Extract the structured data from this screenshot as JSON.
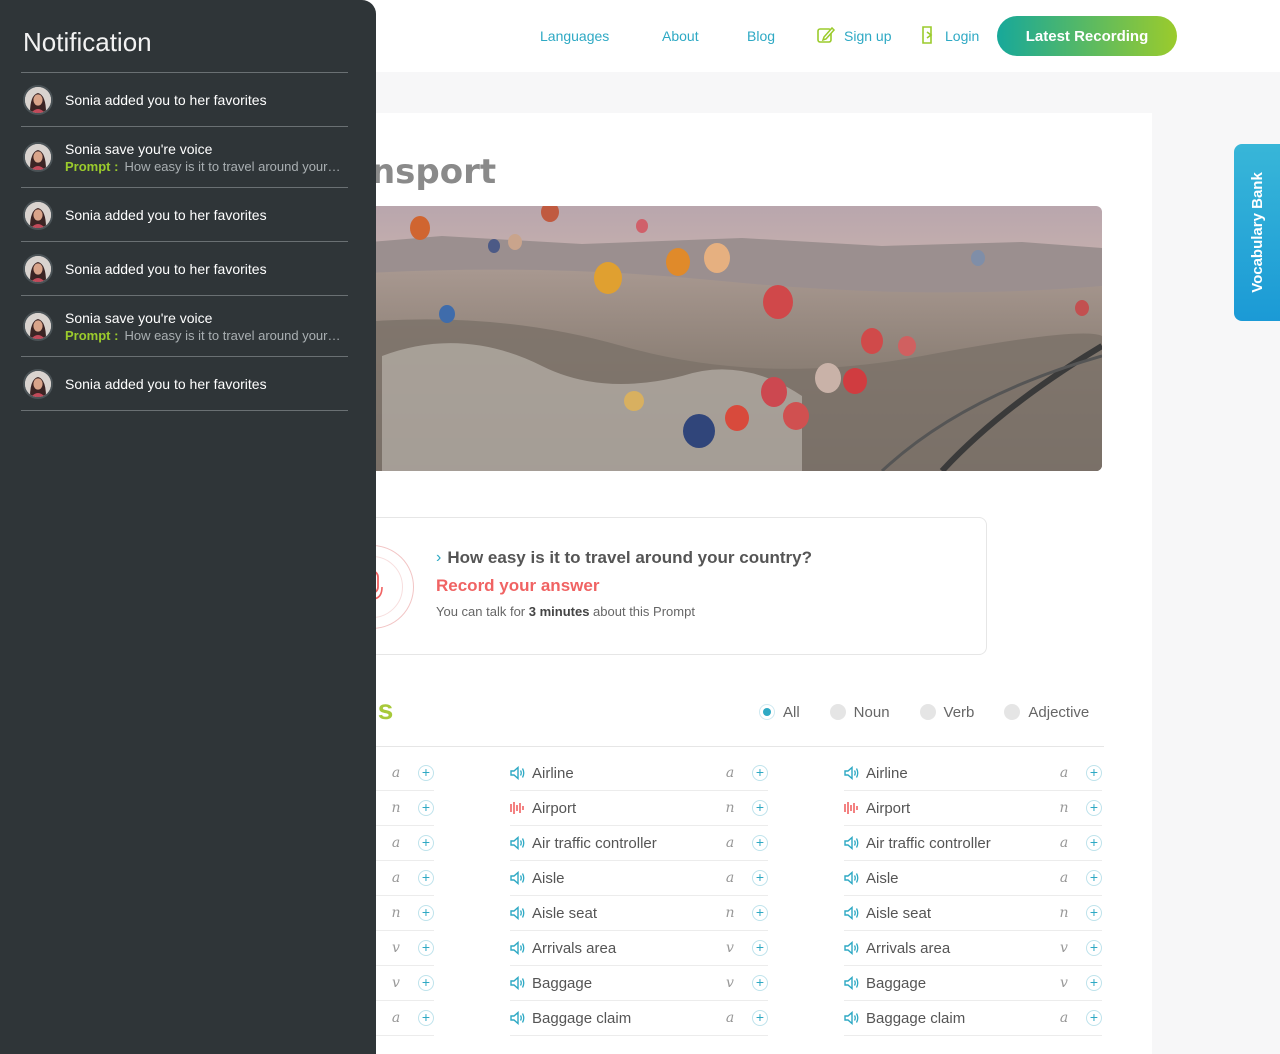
{
  "nav": {
    "languages": "Languages",
    "about": "About",
    "blog": "Blog",
    "signup": "Sign up",
    "login": "Login",
    "latest": "Latest Recording"
  },
  "page": {
    "title_fragment": "ansport"
  },
  "prompt": {
    "question": "How easy is it to travel around your country?",
    "record": "Record your answer",
    "talk_prefix": "You can talk for ",
    "talk_bold": "3 minutes",
    "talk_suffix": " about this Prompt"
  },
  "words": {
    "title_fragment": "ls",
    "filters": [
      "All",
      "Noun",
      "Verb",
      "Adjective"
    ],
    "selected_filter": "All",
    "left_types": [
      "a",
      "n",
      "a",
      "a",
      "n",
      "v",
      "v",
      "a"
    ],
    "items": [
      {
        "word": "Airline",
        "type": "a",
        "icon": "speaker-icon"
      },
      {
        "word": "Airport",
        "type": "n",
        "icon": "audio-wave-icon"
      },
      {
        "word": "Air traffic controller",
        "type": "a",
        "icon": "speaker-icon"
      },
      {
        "word": "Aisle",
        "type": "a",
        "icon": "speaker-icon"
      },
      {
        "word": "Aisle seat",
        "type": "n",
        "icon": "speaker-icon"
      },
      {
        "word": "Arrivals area",
        "type": "v",
        "icon": "speaker-icon"
      },
      {
        "word": "Baggage",
        "type": "v",
        "icon": "speaker-icon"
      },
      {
        "word": "Baggage claim",
        "type": "a",
        "icon": "speaker-icon"
      }
    ]
  },
  "vocab_tab": "Vocabulary Bank",
  "notifications": {
    "title": "Notification",
    "items": [
      {
        "text": "Sonia added you to her favorites"
      },
      {
        "text": "Sonia save you're voice",
        "label": "Prompt :",
        "sub": "How easy is it to travel around your country?"
      },
      {
        "text": "Sonia added you to her favorites"
      },
      {
        "text": "Sonia added you to her favorites"
      },
      {
        "text": "Sonia save you're voice",
        "label": "Prompt :",
        "sub": "How easy is it to travel around your country?"
      },
      {
        "text": "Sonia added you to her favorites"
      }
    ]
  },
  "colors": {
    "accent": "#2ea9c4",
    "green": "#9bcb2c",
    "record": "#f06363",
    "panel": "#2f3538"
  }
}
